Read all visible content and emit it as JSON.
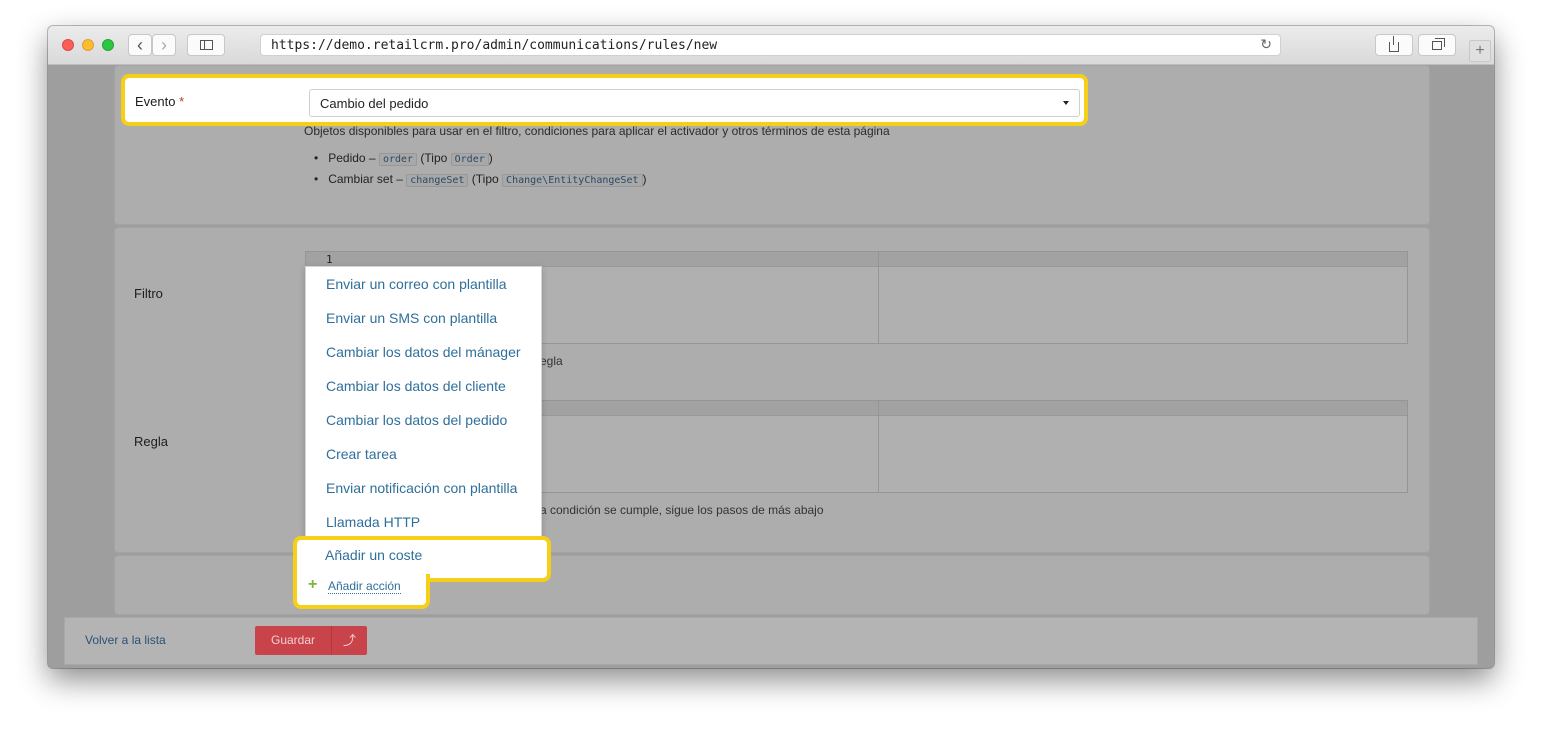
{
  "browser": {
    "url": "https://demo.retailcrm.pro/admin/communications/rules/new",
    "back": "‹",
    "forward": "›",
    "reload": "↻",
    "new_tab": "+"
  },
  "event": {
    "label": "Evento",
    "required_mark": "*",
    "selected": "Cambio del pedido"
  },
  "objects": {
    "description": "Objetos disponibles para usar en el filtro, condiciones para aplicar el activador y otros términos de esta página",
    "items": [
      {
        "name": "Pedido –",
        "code": "order",
        "type_prefix": "(Tipo",
        "type": "Order",
        "type_suffix": ")"
      },
      {
        "name": "Cambiar set –",
        "code": "changeSet",
        "type_prefix": "(Tipo",
        "type": "Change\\EntityChangeSet",
        "type_suffix": ")"
      }
    ]
  },
  "filter": {
    "label": "Filtro",
    "line_number": "1",
    "hint_fragment": "egla"
  },
  "rule": {
    "label": "Regla",
    "hint_fragment": "a condición se cumple, sigue los pasos de más abajo"
  },
  "actions_menu": {
    "items": [
      "Enviar un correo con plantilla",
      "Enviar un SMS con plantilla",
      "Cambiar los datos del mánager",
      "Cambiar los datos del cliente",
      "Cambiar los datos del pedido",
      "Crear tarea",
      "Enviar notificación con plantilla",
      "Llamada HTTP"
    ],
    "highlighted_item": "Añadir un coste"
  },
  "add_action": {
    "icon": "+",
    "label": "Añadir acción"
  },
  "footer": {
    "back_link": "Volver a la lista",
    "save_label": "Guardar",
    "save_arrow": "⤴"
  },
  "colors": {
    "highlight": "#f6cf19",
    "link": "#2f6f9a",
    "save_button": "#c9434a"
  }
}
